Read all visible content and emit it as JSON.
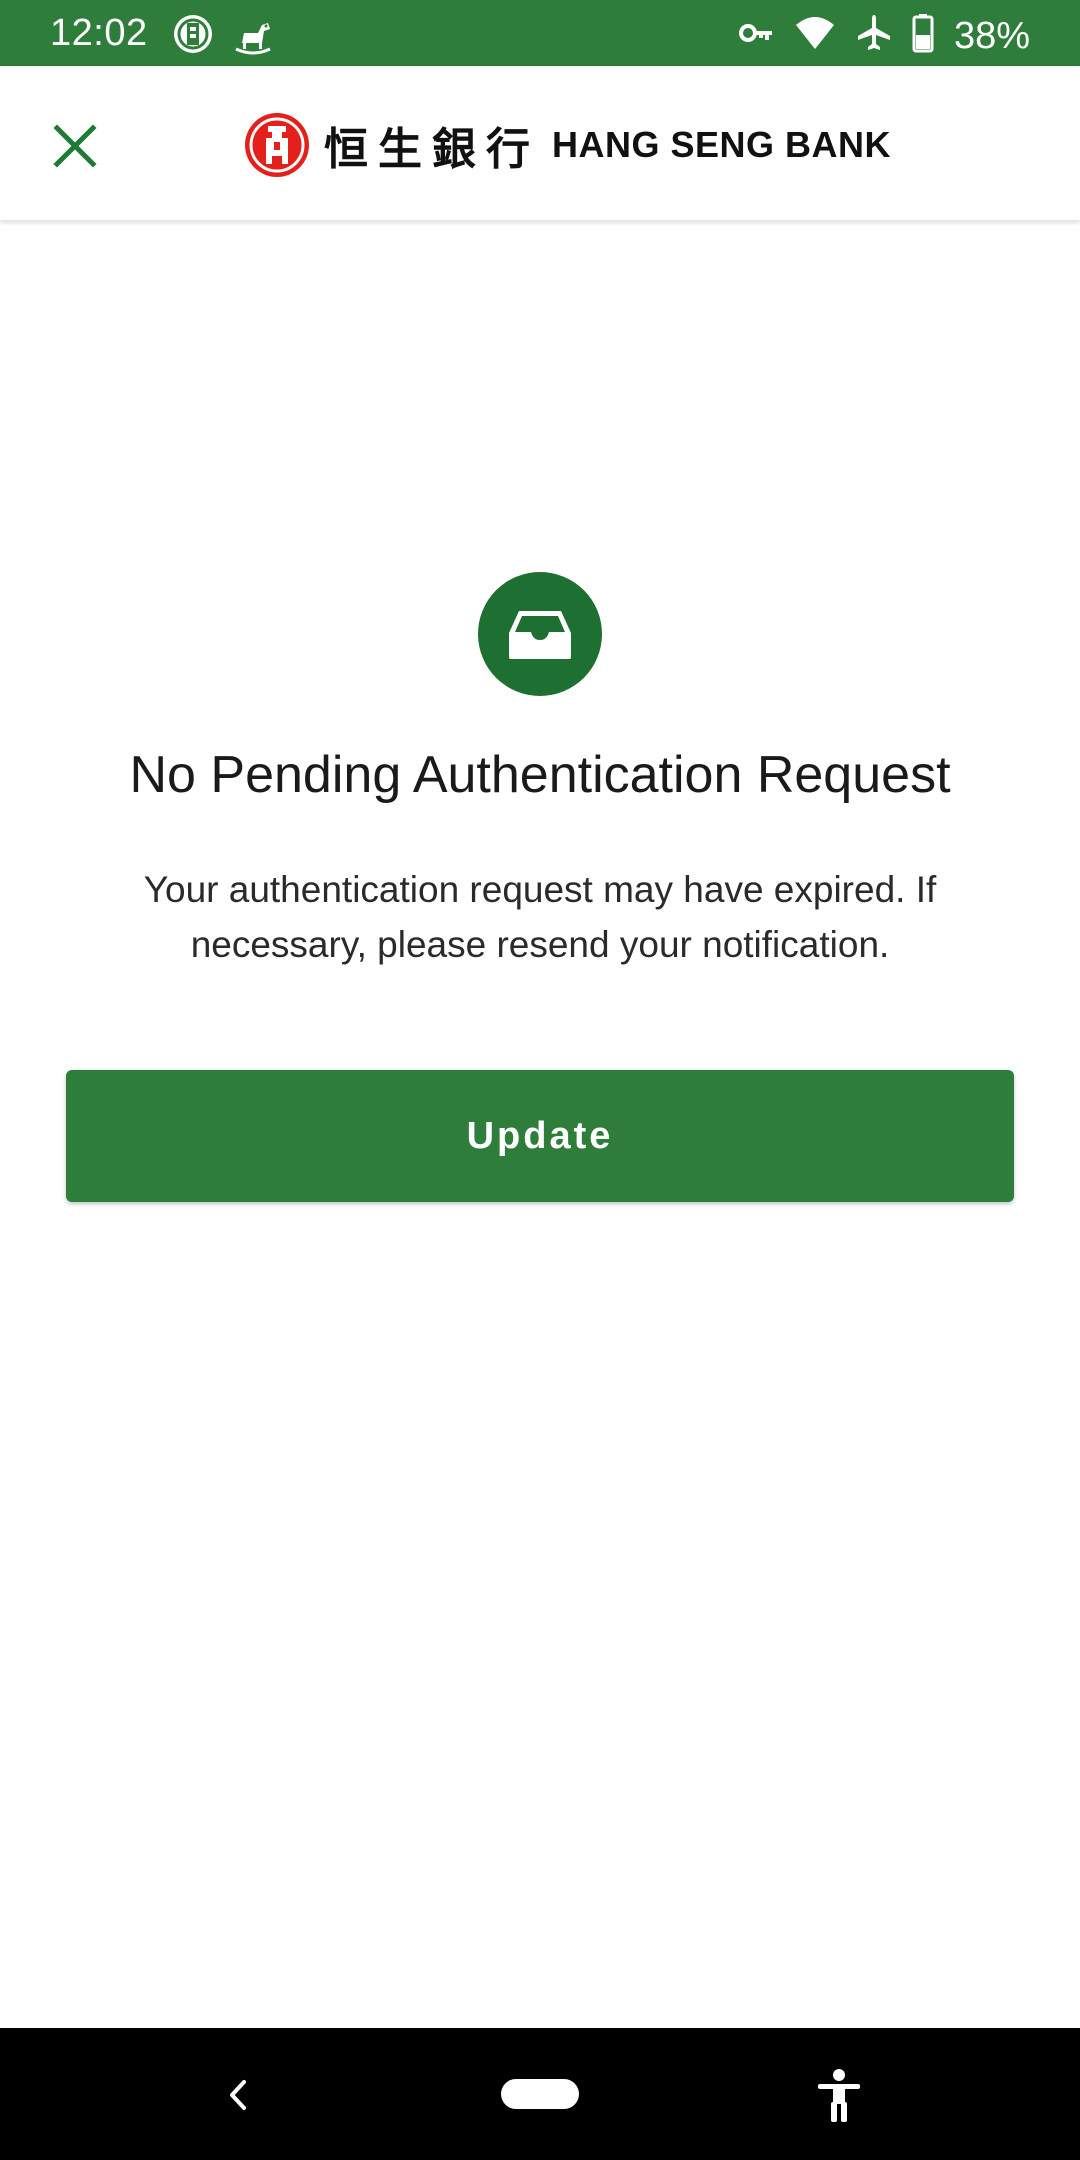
{
  "status_bar": {
    "time": "12:02",
    "battery": "38%",
    "left_icons": [
      "bank-notification-icon",
      "rocking-horse-icon"
    ],
    "right_icons": [
      "vpn-key-icon",
      "wifi-icon",
      "airplane-mode-icon",
      "battery-icon"
    ]
  },
  "app_bar": {
    "close_icon": "close-icon",
    "brand_chinese": "恒生銀行",
    "brand_english": "HANG SENG BANK"
  },
  "main": {
    "icon": "inbox-icon",
    "title": "No Pending Authentication Request",
    "message": "Your authentication request may have expired. If necessary, please resend your notification.",
    "update_button_label": "Update"
  },
  "nav_bar": {
    "icons": [
      "back-icon",
      "home-icon",
      "accessibility-icon"
    ]
  },
  "colors": {
    "brand_green": "#2e7d3a",
    "icon_circle_green": "#1e6f32",
    "logo_red": "#e3201b"
  }
}
